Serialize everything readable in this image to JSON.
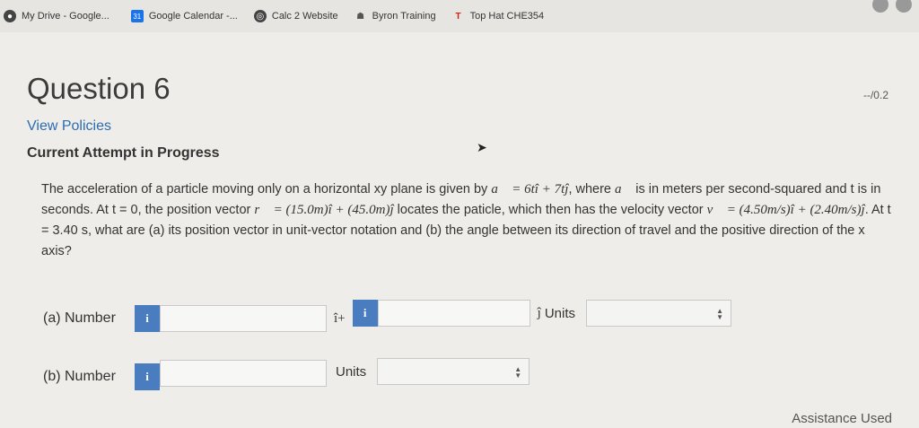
{
  "bookmarks": [
    {
      "label": "My Drive - Google...",
      "icon": "drive-icon"
    },
    {
      "label": "Google Calendar -...",
      "icon": "calendar-icon"
    },
    {
      "label": "Calc 2 Website",
      "icon": "globe-icon"
    },
    {
      "label": "Byron Training",
      "icon": "byron-icon"
    },
    {
      "label": "Top Hat CHE354",
      "icon": "tophat-icon"
    }
  ],
  "question": {
    "title": "Question 6",
    "score": "--/0.2",
    "policies": "View Policies",
    "attempt": "Current Attempt in Progress",
    "text_1": "The acceleration of a particle moving only on a horizontal xy plane is given by",
    "eq_a": "a⃗ = 6tî + 7tĵ",
    "text_2": ", where",
    "a_sym": "a⃗",
    "text_3": "is in meters per second-squared and t is in seconds. At t = 0, the position vector",
    "eq_r": "r⃗ = (15.0m)î + (45.0m)ĵ",
    "text_4": "locates the paticle, which then has the velocity vector",
    "eq_v": "v⃗ = (4.50m/s)î + (2.40m/s)ĵ",
    "text_5": ". At t = 3.40 s, what are (a) its position vector in unit-vector notation and (b) the angle between its direction of travel and the positive direction of the x axis?"
  },
  "part_a": {
    "label": "(a) Number",
    "i_hat": "î+",
    "j_hat": "ĵ",
    "units_label": "Units",
    "value_1": "",
    "value_2": "",
    "units_value": ""
  },
  "part_b": {
    "label": "(b) Number",
    "units_label": "Units",
    "value": "",
    "units_value": ""
  },
  "info_icon": "i",
  "footer": {
    "assistance": "Assistance Used"
  }
}
